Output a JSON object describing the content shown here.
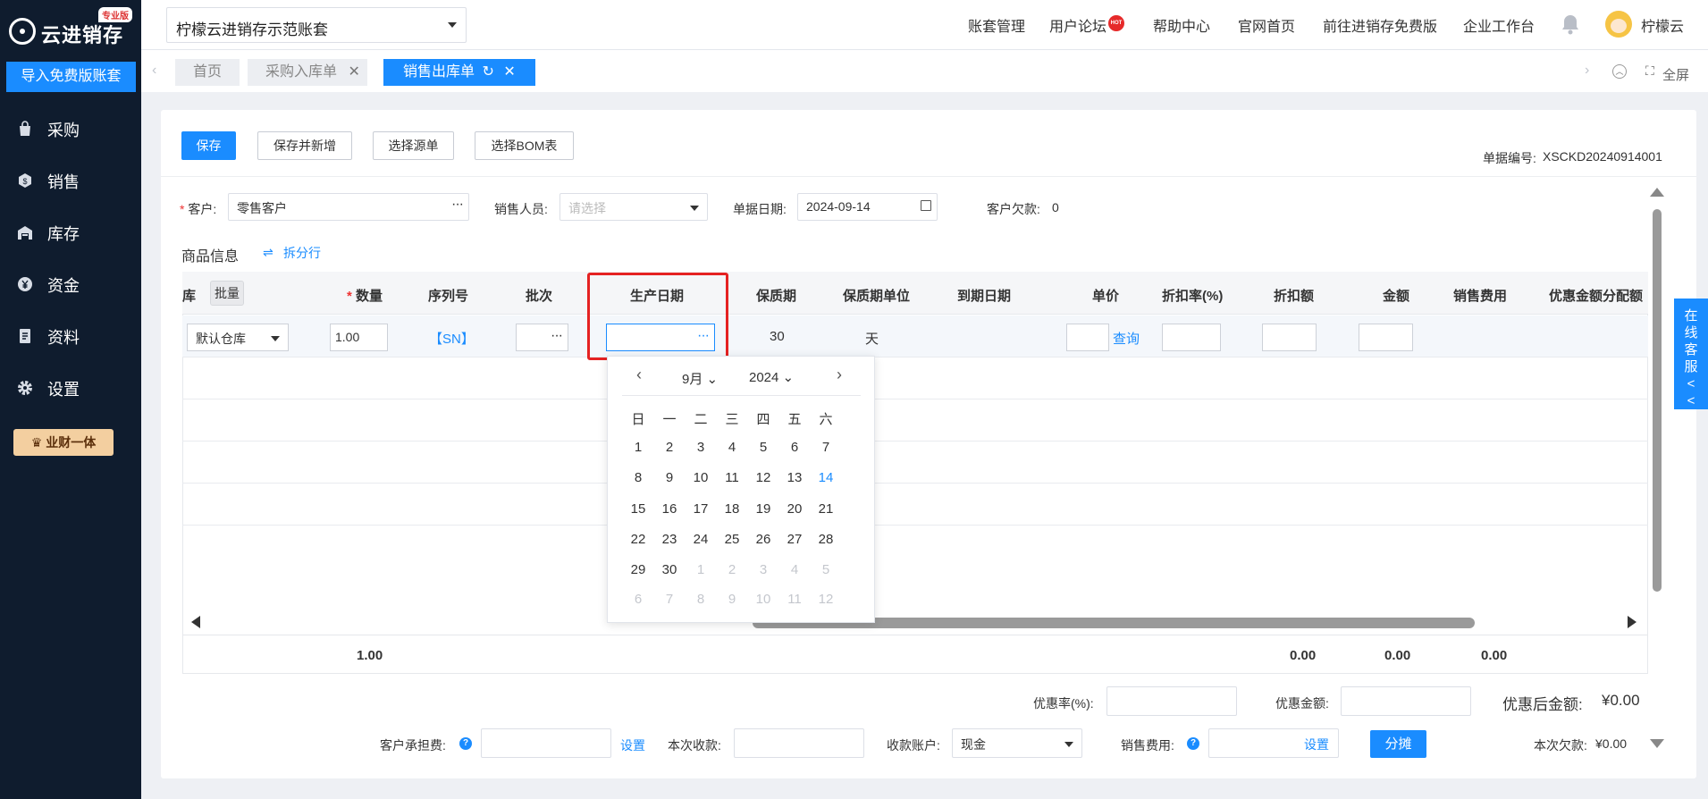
{
  "brand": {
    "name": "云进销存",
    "badge": "专业版",
    "import_button": "导入免费版账套"
  },
  "sidebar": {
    "items": [
      {
        "label": "采购",
        "icon": "bag-icon"
      },
      {
        "label": "销售",
        "icon": "sales-icon"
      },
      {
        "label": "库存",
        "icon": "warehouse-icon"
      },
      {
        "label": "资金",
        "icon": "yen-icon"
      },
      {
        "label": "资料",
        "icon": "document-icon"
      },
      {
        "label": "设置",
        "icon": "gear-icon"
      }
    ],
    "promo": "业财一体"
  },
  "topbar": {
    "account": "柠檬云进销存示范账套",
    "links": [
      "账套管理",
      "用户论坛",
      "帮助中心",
      "官网首页",
      "前往进销存免费版",
      "企业工作台"
    ],
    "hot_badge": "HOT",
    "username": "柠檬云"
  },
  "tabs": {
    "items": [
      {
        "label": "首页",
        "active": false
      },
      {
        "label": "采购入库单",
        "active": false
      },
      {
        "label": "销售出库单",
        "active": true
      }
    ],
    "fullscreen": "全屏"
  },
  "toolbar": {
    "save": "保存",
    "save_new": "保存并新增",
    "select_source": "选择源单",
    "select_bom": "选择BOM表",
    "doc_no_label": "单据编号:",
    "doc_no": "XSCKD20240914001"
  },
  "form": {
    "customer_label": "客户:",
    "customer_value": "零售客户",
    "salesperson_label": "销售人员:",
    "salesperson_placeholder": "请选择",
    "date_label": "单据日期:",
    "date_value": "2024-09-14",
    "debt_label": "客户欠款:",
    "debt_value": "0",
    "goods_info": "商品信息",
    "split_row": "拆分行"
  },
  "grid": {
    "headers": [
      "库",
      "批量",
      "数量",
      "序列号",
      "批次",
      "生产日期",
      "保质期",
      "保质期单位",
      "到期日期",
      "单价",
      "折扣率(%)",
      "折扣额",
      "金额",
      "销售费用",
      "优惠金额分配额"
    ],
    "row": {
      "warehouse": "默认仓库",
      "qty": "1.00",
      "serial": "【SN】",
      "shelf_life": "30",
      "shelf_unit": "天",
      "query": "查询"
    },
    "sum": {
      "qty": "1.00",
      "discount": "0.00",
      "amount": "0.00",
      "fee": "0.00"
    }
  },
  "calendar": {
    "month": "9月",
    "year": "2024",
    "weekdays": [
      "日",
      "一",
      "二",
      "三",
      "四",
      "五",
      "六"
    ],
    "weeks": [
      [
        "1",
        "2",
        "3",
        "4",
        "5",
        "6",
        "7"
      ],
      [
        "8",
        "9",
        "10",
        "11",
        "12",
        "13",
        "14"
      ],
      [
        "15",
        "16",
        "17",
        "18",
        "19",
        "20",
        "21"
      ],
      [
        "22",
        "23",
        "24",
        "25",
        "26",
        "27",
        "28"
      ],
      [
        "29",
        "30",
        "1",
        "2",
        "3",
        "4",
        "5"
      ],
      [
        "6",
        "7",
        "8",
        "9",
        "10",
        "11",
        "12"
      ]
    ],
    "today": "14"
  },
  "footer": {
    "discount_rate_label": "优惠率(%):",
    "discount_amt_label": "优惠金额:",
    "after_discount_label": "优惠后金额:",
    "after_discount_value": "¥0.00",
    "cust_fee_label": "客户承担费:",
    "set": "设置",
    "received_label": "本次收款:",
    "account_label": "收款账户:",
    "account_value": "现金",
    "sales_fee_label": "销售费用:",
    "allocate": "分摊",
    "debt_label": "本次欠款:",
    "debt_value": "¥0.00"
  },
  "service": "在线客服<<",
  "colors": {
    "primary": "#1a8cff",
    "sidebar": "#0f1c2e",
    "highlight": "#e52222"
  }
}
